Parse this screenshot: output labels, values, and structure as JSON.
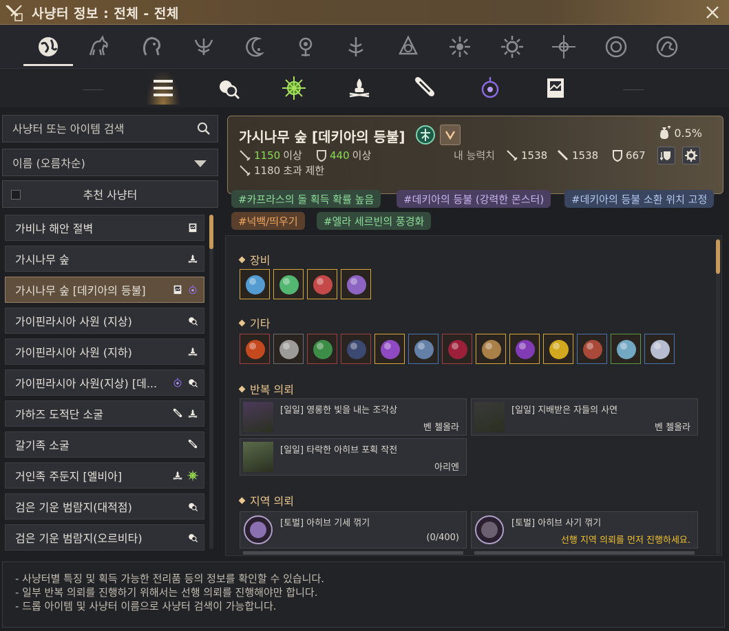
{
  "window": {
    "title": "사냥터 정보 : 전체 - 전체"
  },
  "categories": [
    {
      "icon": "globe-icon",
      "active": true
    },
    {
      "icon": "horse-icon"
    },
    {
      "icon": "lion-icon"
    },
    {
      "icon": "eagle-crest-icon"
    },
    {
      "icon": "crescent-moon-icon"
    },
    {
      "icon": "lantern-icon"
    },
    {
      "icon": "flame-tree-icon"
    },
    {
      "icon": "knot-icon"
    },
    {
      "icon": "sun-burst-icon"
    },
    {
      "icon": "sun-icon"
    },
    {
      "icon": "star-compass-icon"
    },
    {
      "icon": "ornament-circle-icon"
    },
    {
      "icon": "rune-circle-icon"
    }
  ],
  "subtabs": [
    {
      "icon": "list-icon",
      "active": true
    },
    {
      "icon": "monster-search-icon"
    },
    {
      "icon": "green-compass-icon"
    },
    {
      "icon": "campfire-icon"
    },
    {
      "icon": "scroll-icon"
    },
    {
      "icon": "purple-lantern-icon"
    },
    {
      "icon": "picture-frame-icon"
    }
  ],
  "search": {
    "placeholder": "사냥터 또는 아이템 검색"
  },
  "sort": {
    "label": "이름 (오름차순)"
  },
  "recommend": {
    "label": "추천 사냥터"
  },
  "list": [
    {
      "name": "가비냐 해안 절벽",
      "icons": [
        "picture-frame-icon"
      ]
    },
    {
      "name": "가시나무 숲",
      "icons": [
        "campfire-icon"
      ]
    },
    {
      "name": "가시나무 숲 [데키아의 등불]",
      "icons": [
        "picture-frame-icon",
        "purple-lantern-icon"
      ],
      "selected": true
    },
    {
      "name": "가이핀라시아 사원 (지상)",
      "icons": [
        "monster-search-icon"
      ]
    },
    {
      "name": "가이핀라시아 사원 (지하)",
      "icons": [
        "campfire-icon"
      ]
    },
    {
      "name": "가이핀라시아 사원(지상) [데...",
      "icons": [
        "purple-lantern-icon",
        "monster-search-icon"
      ]
    },
    {
      "name": "가하즈 도적단 소굴",
      "icons": [
        "scroll-icon",
        "campfire-icon"
      ]
    },
    {
      "name": "갈기족 소굴",
      "icons": [
        "scroll-icon"
      ]
    },
    {
      "name": "거인족 주둔지 [엘비아]",
      "icons": [
        "campfire-icon",
        "green-compass-icon"
      ]
    },
    {
      "name": "검은 기운 범람지(대적점)",
      "icons": [
        "monster-search-icon"
      ]
    },
    {
      "name": "검은 기운 범람지(오르비타)",
      "icons": [
        "monster-search-icon"
      ]
    }
  ],
  "header": {
    "name": "가시나무 숲 [데키아의 등불]",
    "drop_rate": "0.5%",
    "req_ap": "1150",
    "req_ap_suffix": "이상",
    "req_dp": "440",
    "req_dp_suffix": "이상",
    "limit_ap": "1180",
    "limit_suffix": "초과 제한",
    "my_label": "내 능력치",
    "my_ap": "1538",
    "my_aap": "1538",
    "my_dp": "667"
  },
  "tags": [
    {
      "text": "#카프라스의 돌 획득 확률 높음",
      "color": "#8edc9a",
      "bg": "#334a3c"
    },
    {
      "text": "#데키아의 등불 (강력한 몬스터)",
      "color": "#c8b4f0",
      "bg": "#4a3f60"
    },
    {
      "text": "#데키아의 등불 소환 위치 고정",
      "color": "#b4c8f0",
      "bg": "#3a4560"
    },
    {
      "text": "#넉백/띄우기",
      "color": "#f0a860",
      "bg": "#5a3f2c"
    },
    {
      "text": "#엘라 세르빈의 풍경화",
      "color": "#8edc9a",
      "bg": "#334a3c"
    }
  ],
  "sections": {
    "equipment": "장비",
    "misc": "기타",
    "repeat_quest": "반복 의뢰",
    "region_quest": "지역 의뢰"
  },
  "equipment_items": [
    {
      "icon": "rosar-earring-blue-icon",
      "color": "#5ab0f0"
    },
    {
      "icon": "rosar-earring-green-icon",
      "color": "#5ad080"
    },
    {
      "icon": "rosar-earring-red-icon",
      "color": "#e05050"
    },
    {
      "icon": "violet-ring-icon",
      "color": "#a070e0"
    }
  ],
  "misc_items": [
    {
      "icon": "red-spark-icon",
      "color": "#e05020"
    },
    {
      "icon": "grey-leaf-icon",
      "color": "#b0b0b0"
    },
    {
      "icon": "green-fang-icon",
      "color": "#40a050"
    },
    {
      "icon": "dark-crystal-icon",
      "color": "#405080"
    },
    {
      "icon": "purple-lantern-item-icon",
      "color": "#a050e0"
    },
    {
      "icon": "black-stone-icon",
      "color": "#7090c0"
    },
    {
      "icon": "red-gem-icon",
      "color": "#b02040"
    },
    {
      "icon": "treasure-chest-icon",
      "color": "#c09050"
    },
    {
      "icon": "purple-cube-icon",
      "color": "#9040d0"
    },
    {
      "icon": "gold-drop-icon",
      "color": "#f0c020"
    },
    {
      "icon": "red-claw-icon",
      "color": "#c05040"
    },
    {
      "icon": "potion-vial-icon",
      "color": "#80c0e0"
    },
    {
      "icon": "silver-shards-icon",
      "color": "#d0d8f0"
    }
  ],
  "repeat_quests": [
    {
      "title": "[일일] 영롱한 빛을 내는 조각상",
      "giver": "벤 첼올라",
      "img": "#4b3a5a"
    },
    {
      "title": "[일일] 지배받은 자들의 사연",
      "giver": "벤 첼올라",
      "img": "#3a3a3a"
    },
    {
      "title": "[일일] 타락한 아히브 포획 작전",
      "giver": "아리엔",
      "img": "#5a6a4a"
    }
  ],
  "region_quests": [
    {
      "title": "[토벌] 아히브 기세 꺾기",
      "status": "(0/400)",
      "warn": false
    },
    {
      "title": "[토벌] 아히브 사기 꺾기",
      "status": "선행 지역 의뢰를 먼저 진행하세요.",
      "warn": true
    }
  ],
  "footer": [
    "- 사냥터별 특징 및 획득 가능한 전리품 등의 정보를 확인할 수 있습니다.",
    "- 일부 반복 의뢰를 진행하기 위해서는 선행 의뢰를 진행해야만 합니다.",
    "- 드롭 아이템 및 사냥터 이름으로 사냥터 검색이 가능합니다."
  ]
}
